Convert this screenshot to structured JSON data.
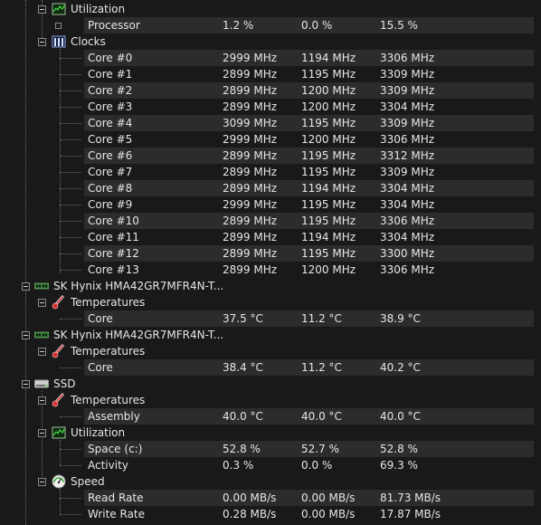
{
  "cpu": {
    "utilization_label": "Utilization",
    "processor": {
      "label": "Processor",
      "value": "1.2 %",
      "min": "0.0 %",
      "max": "15.5 %"
    },
    "clocks_label": "Clocks",
    "cores": [
      {
        "label": "Core #0",
        "value": "2999 MHz",
        "min": "1194 MHz",
        "max": "3306 MHz"
      },
      {
        "label": "Core #1",
        "value": "2899 MHz",
        "min": "1195 MHz",
        "max": "3309 MHz"
      },
      {
        "label": "Core #2",
        "value": "2899 MHz",
        "min": "1200 MHz",
        "max": "3309 MHz"
      },
      {
        "label": "Core #3",
        "value": "2899 MHz",
        "min": "1200 MHz",
        "max": "3304 MHz"
      },
      {
        "label": "Core #4",
        "value": "3099 MHz",
        "min": "1195 MHz",
        "max": "3309 MHz"
      },
      {
        "label": "Core #5",
        "value": "2999 MHz",
        "min": "1200 MHz",
        "max": "3306 MHz"
      },
      {
        "label": "Core #6",
        "value": "2899 MHz",
        "min": "1195 MHz",
        "max": "3312 MHz"
      },
      {
        "label": "Core #7",
        "value": "2899 MHz",
        "min": "1195 MHz",
        "max": "3309 MHz"
      },
      {
        "label": "Core #8",
        "value": "2899 MHz",
        "min": "1194 MHz",
        "max": "3304 MHz"
      },
      {
        "label": "Core #9",
        "value": "2999 MHz",
        "min": "1195 MHz",
        "max": "3304 MHz"
      },
      {
        "label": "Core #10",
        "value": "2899 MHz",
        "min": "1195 MHz",
        "max": "3306 MHz"
      },
      {
        "label": "Core #11",
        "value": "2899 MHz",
        "min": "1194 MHz",
        "max": "3304 MHz"
      },
      {
        "label": "Core #12",
        "value": "2899 MHz",
        "min": "1195 MHz",
        "max": "3300 MHz"
      },
      {
        "label": "Core #13",
        "value": "2899 MHz",
        "min": "1200 MHz",
        "max": "3306 MHz"
      }
    ]
  },
  "ram1": {
    "label": "SK Hynix HMA42GR7MFR4N-T...",
    "temperatures_label": "Temperatures",
    "core": {
      "label": "Core",
      "value": "37.5 °C",
      "min": "11.2 °C",
      "max": "38.9 °C"
    }
  },
  "ram2": {
    "label": "SK Hynix HMA42GR7MFR4N-T...",
    "temperatures_label": "Temperatures",
    "core": {
      "label": "Core",
      "value": "38.4 °C",
      "min": "11.2 °C",
      "max": "40.2 °C"
    }
  },
  "ssd": {
    "label": "SSD",
    "temperatures_label": "Temperatures",
    "assembly": {
      "label": "Assembly",
      "value": "40.0 °C",
      "min": "40.0 °C",
      "max": "40.0 °C"
    },
    "utilization_label": "Utilization",
    "space": {
      "label": "Space (c:)",
      "value": "52.8 %",
      "min": "52.7 %",
      "max": "52.8 %"
    },
    "activity": {
      "label": "Activity",
      "value": "0.3 %",
      "min": "0.0 %",
      "max": "69.3 %"
    },
    "speed_label": "Speed",
    "read": {
      "label": "Read Rate",
      "value": "0.00 MB/s",
      "min": "0.00 MB/s",
      "max": "81.73 MB/s"
    },
    "write": {
      "label": "Write Rate",
      "value": "0.28 MB/s",
      "min": "0.00 MB/s",
      "max": "17.87 MB/s"
    }
  },
  "colors": {
    "background": "#191919",
    "row_shade": "#2c2c2c",
    "text": "#e6e6e6",
    "tree_line": "#6a6a6a"
  },
  "icons": {
    "utilization": "utilization-graph-icon",
    "clocks": "clock-bars-icon",
    "temperatures": "thermometer-icon",
    "ram": "ram-module-icon",
    "ssd": "drive-icon",
    "speed": "gauge-icon"
  }
}
